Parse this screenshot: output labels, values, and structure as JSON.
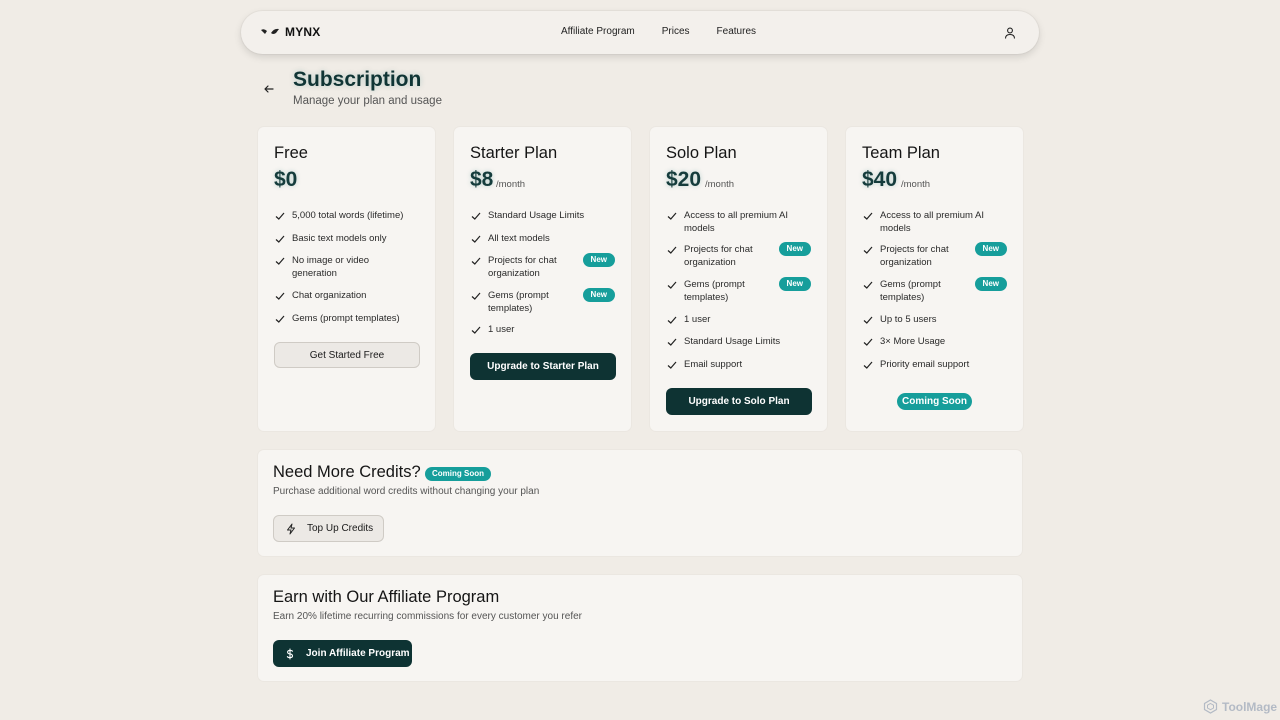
{
  "nav": {
    "logo_text": "MYNX",
    "links": [
      "Affiliate Program",
      "Prices",
      "Features"
    ]
  },
  "header": {
    "title": "Subscription",
    "subtitle": "Manage your plan and usage"
  },
  "plans": [
    {
      "name": "Free",
      "price": "$0",
      "period": "",
      "features": [
        "5,000 total words (lifetime)",
        "Basic text models only",
        "No image or video generation",
        "Chat organization",
        "Gems (prompt templates)"
      ],
      "cta": "Get Started Free"
    },
    {
      "name": "Starter Plan",
      "price": "$8",
      "period": "/month",
      "features": [
        "Standard Usage Limits",
        "All text models",
        "Projects for chat organization",
        "Gems (prompt templates)",
        "1 user"
      ],
      "badges": [
        "New",
        "New"
      ],
      "cta": "Upgrade to Starter Plan"
    },
    {
      "name": "Solo Plan",
      "price": "$20",
      "period": "/month",
      "features": [
        "Access to all premium AI models",
        "Projects for chat organization",
        "Gems (prompt templates)",
        "1 user",
        "Standard Usage Limits",
        "Email support"
      ],
      "badges": [
        "New",
        "New"
      ],
      "cta": "Upgrade to Solo Plan"
    },
    {
      "name": "Team Plan",
      "price": "$40",
      "period": "/month",
      "features": [
        "Access to all premium AI models",
        "Projects for chat organization",
        "Gems (prompt templates)",
        "Up to 5 users",
        "3× More Usage",
        "Priority email support"
      ],
      "badges": [
        "New",
        "New"
      ],
      "cta": "Coming Soon"
    }
  ],
  "credits": {
    "title": "Need More Credits?",
    "badge": "Coming Soon",
    "description": "Purchase additional word credits without changing your plan",
    "button": "Top Up Credits"
  },
  "affiliate": {
    "title": "Earn with Our Affiliate Program",
    "description": "Earn 20% lifetime recurring commissions for every customer you refer",
    "button": "Join Affiliate Program"
  },
  "watermark": "ToolMage",
  "colors": {
    "accent": "#169e9b",
    "dark_button": "#0e3333",
    "background": "#f0ece6"
  }
}
